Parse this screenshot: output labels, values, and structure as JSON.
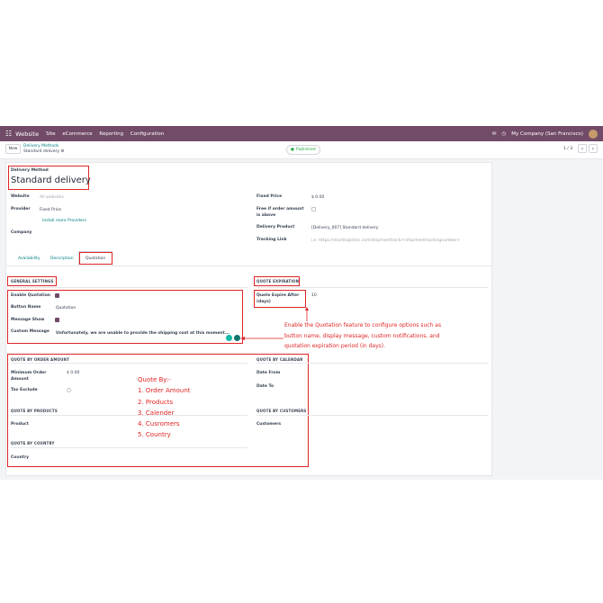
{
  "topbar": {
    "brand": "Website",
    "menu": [
      "Site",
      "eCommerce",
      "Reporting",
      "Configuration"
    ],
    "company": "My Company (San Francisco)"
  },
  "control": {
    "new_label": "New",
    "breadcrumb_parent": "Delivery Methods",
    "breadcrumb_current": "Standard delivery",
    "published_label": "Published",
    "pager": "1 / 3"
  },
  "form": {
    "title_label": "Delivery Method",
    "title": "Standard delivery",
    "website_label": "Website",
    "website_placeholder": "All websites",
    "provider_label": "Provider",
    "provider_value": "Fixed Price",
    "install_link": "Install more Providers",
    "company_label": "Company",
    "fixed_price_label": "Fixed Price",
    "fixed_price_value": "$ 0.00",
    "free_label": "Free if order amount is above",
    "delivery_product_label": "Delivery Product",
    "delivery_product_value": "[Delivery_007] Standard delivery",
    "tracking_label": "Tracking Link",
    "tracking_placeholder": "i.e. https://ekartlogistics.com/shipmenttrack/<shipmenttrackingnumber>"
  },
  "tabs": [
    "Availability",
    "Description",
    "Quotation"
  ],
  "general": {
    "header": "GENERAL SETTINGS",
    "enable_label": "Enable Quotation",
    "button_name_label": "Button Name",
    "button_name_value": "Quotation",
    "message_show_label": "Message Show",
    "custom_message_label": "Custom Message",
    "custom_message_value": "Unfortunately, we are unable to provide the shipping cost at this moment..."
  },
  "expiration": {
    "header": "QUOTE EXPIRATION",
    "label": "Quote Expire After (days)",
    "value": "10"
  },
  "by_order": {
    "header": "QUOTE BY ORDER AMOUNT",
    "min_label": "Minimum Order Amount",
    "min_value": "$ 0.00",
    "tax_label": "Tax Exclude"
  },
  "by_calendar": {
    "header": "QUOTE BY CALENDAR",
    "from_label": "Date From",
    "to_label": "Date To"
  },
  "by_products": {
    "header": "QUOTE BY PRODUCTS",
    "label": "Product"
  },
  "by_customers": {
    "header": "QUOTE BY CUSTOMERS",
    "label": "Customers"
  },
  "by_country": {
    "header": "QUOTE BY COUNTRY",
    "label": "Country"
  },
  "annotations": {
    "quotation_note": "Enable the Quotation feature to configure options such as button name, display message, custom notifications, and quotation expiration period (in days).",
    "quote_by_title": "Quote By:-",
    "quote_by_items": [
      "1. Order Amount",
      "2. Products",
      "3. Calender",
      "4. Cusromers",
      "5. Country"
    ]
  },
  "colors": {
    "topbar": "#714b67",
    "accent": "#017e84",
    "annotation": "#e02424"
  }
}
